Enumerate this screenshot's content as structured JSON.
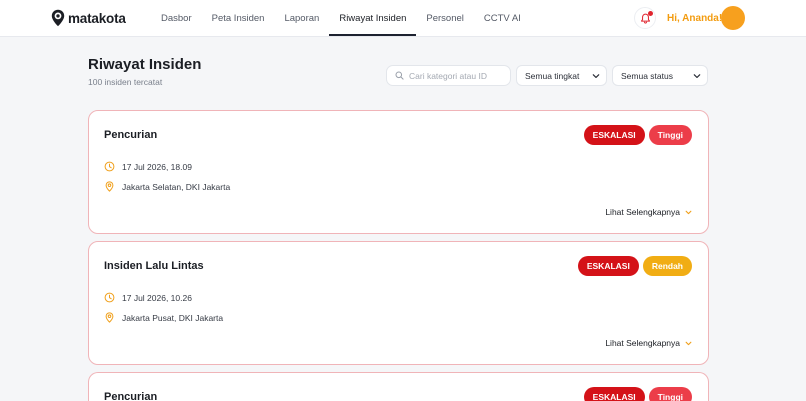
{
  "app": {
    "name": "matakota"
  },
  "nav": {
    "items": [
      {
        "label": "Dasbor"
      },
      {
        "label": "Peta Insiden"
      },
      {
        "label": "Laporan"
      },
      {
        "label": "Riwayat Insiden"
      },
      {
        "label": "Personel"
      },
      {
        "label": "CCTV AI"
      }
    ],
    "active_index": 3
  },
  "header": {
    "greeting": "Hi, Ananda!",
    "notification_icon": "bell-icon",
    "avatar_color": "#f7a01e"
  },
  "page": {
    "title": "Riwayat Insiden",
    "subtitle": "100 insiden tercatat"
  },
  "filters": {
    "search_placeholder": "Cari kategori atau ID",
    "level": "Semua tingkat",
    "status": "Semua status"
  },
  "incidents": [
    {
      "title": "Pencurian",
      "status": "ESKALASI",
      "severity": "Tinggi",
      "time": "17 Jul 2026, 18.09",
      "location": "Jakarta Selatan, DKI Jakarta",
      "more_label": "Lihat Selengkapnya"
    },
    {
      "title": "Insiden Lalu Lintas",
      "status": "ESKALASI",
      "severity": "Rendah",
      "time": "17 Jul 2026, 10.26",
      "location": "Jakarta Pusat, DKI Jakarta",
      "more_label": "Lihat Selengkapnya"
    },
    {
      "title": "Pencurian",
      "status": "ESKALASI",
      "severity": "Tinggi"
    }
  ],
  "colors": {
    "accent": "#f39c10",
    "escalation": "#d41218",
    "severity_high": "#ec3d49",
    "severity_low": "#f1ad14",
    "card_border": "#f0b4b8"
  }
}
